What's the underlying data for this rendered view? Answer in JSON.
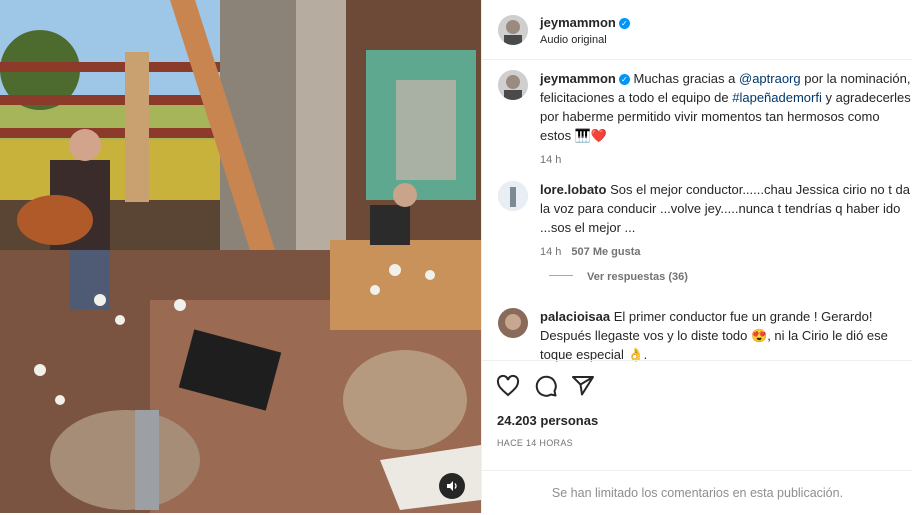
{
  "post": {
    "author": "jeymammon",
    "audio": "Audio original",
    "caption_user": "jeymammon",
    "caption_parts": [
      "Muchas gracias a ",
      "@aptraorg",
      " por la nominación, felicitaciones a todo el equipo de ",
      "#lapeñademorfi",
      " y agradecerles por haberme permitido vivir momentos tan hermosos como estos 🎹❤️"
    ],
    "caption_time": "14 h"
  },
  "comments": [
    {
      "user": "lore.lobato",
      "text": "Sos el mejor conductor......chau Jessica cirio no t da la voz para conducir ...volve jey.....nunca t tendrías q haber ido ...sos el mejor ...",
      "time": "14 h",
      "likes": "507 Me gusta",
      "replies": "Ver respuestas (36)"
    },
    {
      "user": "palacioisaa",
      "text": "El primer conductor fue un grande ! Gerardo! Después llegaste vos y lo diste todo 😍, ni la Cirio le dió ese toque especial 👌."
    }
  ],
  "footer": {
    "likes_count": "24.203 personas",
    "timestamp": "HACE 14 HORAS",
    "comments_limited": "Se han limitado los comentarios en esta publicación."
  },
  "icons": [
    "heart-icon",
    "comment-icon",
    "share-icon",
    "sound-icon",
    "verified-badge-icon"
  ]
}
